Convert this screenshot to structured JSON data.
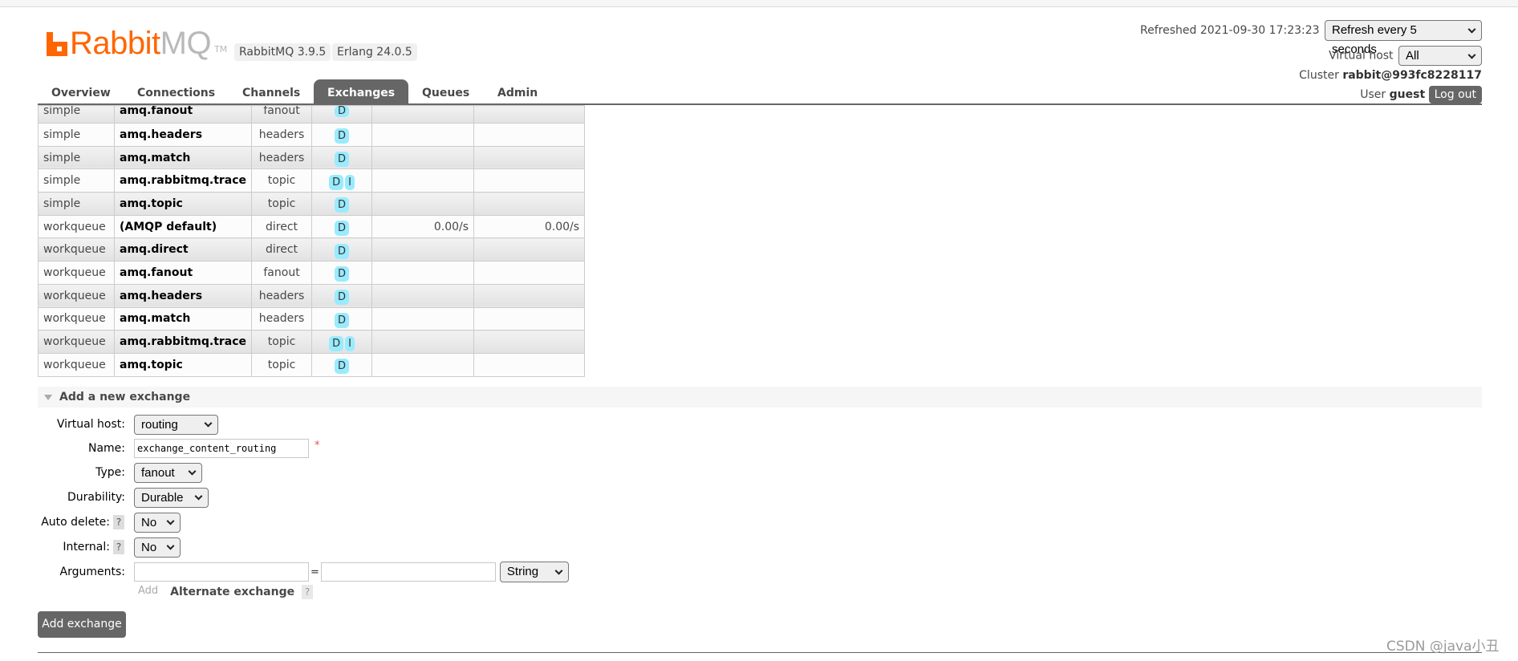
{
  "header": {
    "logo": {
      "rabbit": "Rabbit",
      "mq": "MQ",
      "tm": "TM"
    },
    "versions": [
      "RabbitMQ 3.9.5",
      "Erlang 24.0.5"
    ],
    "refreshed_label": "Refreshed 2021-09-30 17:23:23",
    "refresh_select": "Refresh every 5 seconds",
    "virtual_host_label": "Virtual host",
    "virtual_host_select": "All",
    "cluster_label": "Cluster",
    "cluster_name": "rabbit@993fc8228117",
    "user_label": "User",
    "user_name": "guest",
    "logout_label": "Log out"
  },
  "tabs": [
    {
      "label": "Overview",
      "active": false
    },
    {
      "label": "Connections",
      "active": false
    },
    {
      "label": "Channels",
      "active": false
    },
    {
      "label": "Exchanges",
      "active": true
    },
    {
      "label": "Queues",
      "active": false
    },
    {
      "label": "Admin",
      "active": false
    }
  ],
  "exchanges": {
    "rows": [
      {
        "vhost": "simple",
        "name": "amq.fanout",
        "type": "fanout",
        "features": [
          "D"
        ],
        "rate_in": "",
        "rate_out": ""
      },
      {
        "vhost": "simple",
        "name": "amq.headers",
        "type": "headers",
        "features": [
          "D"
        ],
        "rate_in": "",
        "rate_out": ""
      },
      {
        "vhost": "simple",
        "name": "amq.match",
        "type": "headers",
        "features": [
          "D"
        ],
        "rate_in": "",
        "rate_out": ""
      },
      {
        "vhost": "simple",
        "name": "amq.rabbitmq.trace",
        "type": "topic",
        "features": [
          "D",
          "I"
        ],
        "rate_in": "",
        "rate_out": ""
      },
      {
        "vhost": "simple",
        "name": "amq.topic",
        "type": "topic",
        "features": [
          "D"
        ],
        "rate_in": "",
        "rate_out": ""
      },
      {
        "vhost": "workqueue",
        "name": "(AMQP default)",
        "type": "direct",
        "features": [
          "D"
        ],
        "rate_in": "0.00/s",
        "rate_out": "0.00/s"
      },
      {
        "vhost": "workqueue",
        "name": "amq.direct",
        "type": "direct",
        "features": [
          "D"
        ],
        "rate_in": "",
        "rate_out": ""
      },
      {
        "vhost": "workqueue",
        "name": "amq.fanout",
        "type": "fanout",
        "features": [
          "D"
        ],
        "rate_in": "",
        "rate_out": ""
      },
      {
        "vhost": "workqueue",
        "name": "amq.headers",
        "type": "headers",
        "features": [
          "D"
        ],
        "rate_in": "",
        "rate_out": ""
      },
      {
        "vhost": "workqueue",
        "name": "amq.match",
        "type": "headers",
        "features": [
          "D"
        ],
        "rate_in": "",
        "rate_out": ""
      },
      {
        "vhost": "workqueue",
        "name": "amq.rabbitmq.trace",
        "type": "topic",
        "features": [
          "D",
          "I"
        ],
        "rate_in": "",
        "rate_out": ""
      },
      {
        "vhost": "workqueue",
        "name": "amq.topic",
        "type": "topic",
        "features": [
          "D"
        ],
        "rate_in": "",
        "rate_out": ""
      }
    ]
  },
  "add_exchange": {
    "section_title": "Add a new exchange",
    "virtual_host_label": "Virtual host:",
    "virtual_host_value": "routing",
    "name_label": "Name:",
    "name_value": "exchange_content_routing",
    "required_mark": "*",
    "type_label": "Type:",
    "type_value": "fanout",
    "durability_label": "Durability:",
    "durability_value": "Durable",
    "auto_delete_label": "Auto delete:",
    "auto_delete_value": "No",
    "internal_label": "Internal:",
    "internal_value": "No",
    "help_mark": "?",
    "arguments_label": "Arguments:",
    "arguments_key": "",
    "arguments_value": "",
    "equals": "=",
    "arguments_type": "String",
    "add_link": "Add",
    "alternate_exchange_label": "Alternate exchange",
    "submit_label": "Add exchange"
  },
  "watermark": "CSDN @java小丑"
}
